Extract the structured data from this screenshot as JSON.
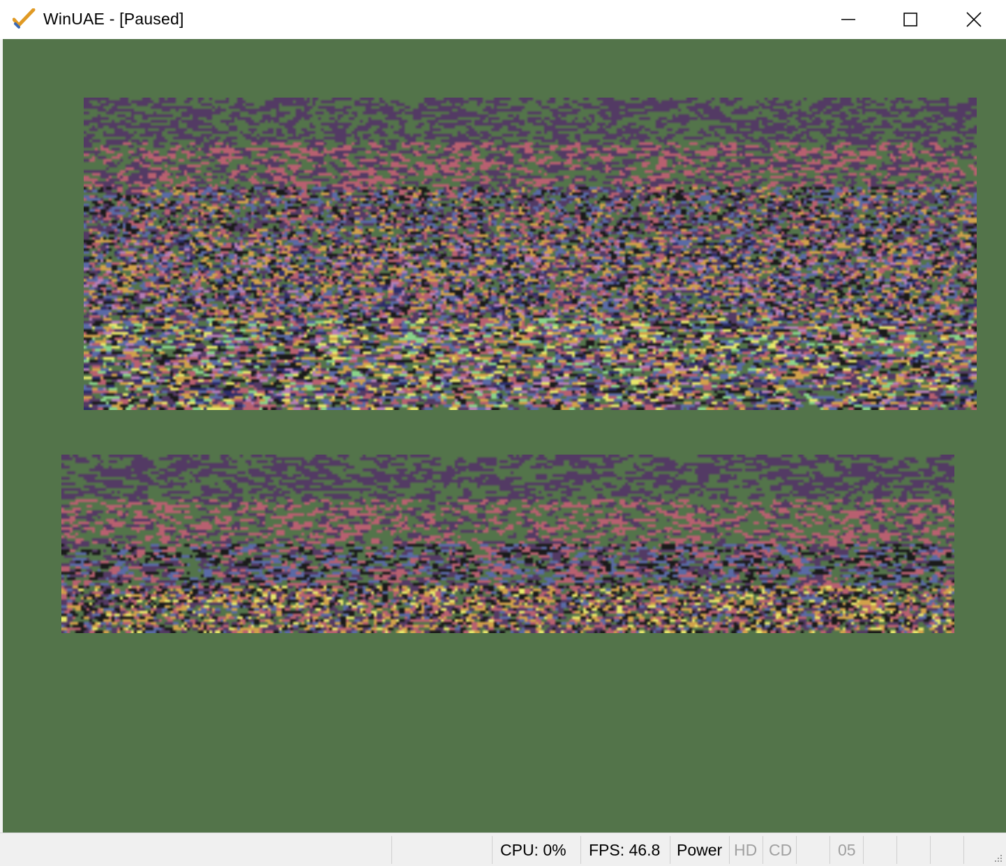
{
  "window": {
    "title": "WinUAE - [Paused]",
    "icon": "checkmark-app-icon",
    "controls": {
      "minimize": "minimize-icon",
      "maximize": "maximize-icon",
      "close": "close-icon"
    }
  },
  "display": {
    "background": "#53744a",
    "regions": [
      "upper-glitch-graphics",
      "lower-glitch-graphics"
    ],
    "palette": [
      "#53744a",
      "#533a64",
      "#b86070",
      "#5a6aa6",
      "#1a1a1a",
      "#d2a24a",
      "#e8e86a",
      "#b67fb8",
      "#8ad48a",
      "#2c2c6a"
    ]
  },
  "statusbar": {
    "cpu": "CPU: 0%",
    "fps": "FPS: 46.8",
    "power": "Power",
    "hd": "HD",
    "cd": "CD",
    "drive": "05"
  }
}
